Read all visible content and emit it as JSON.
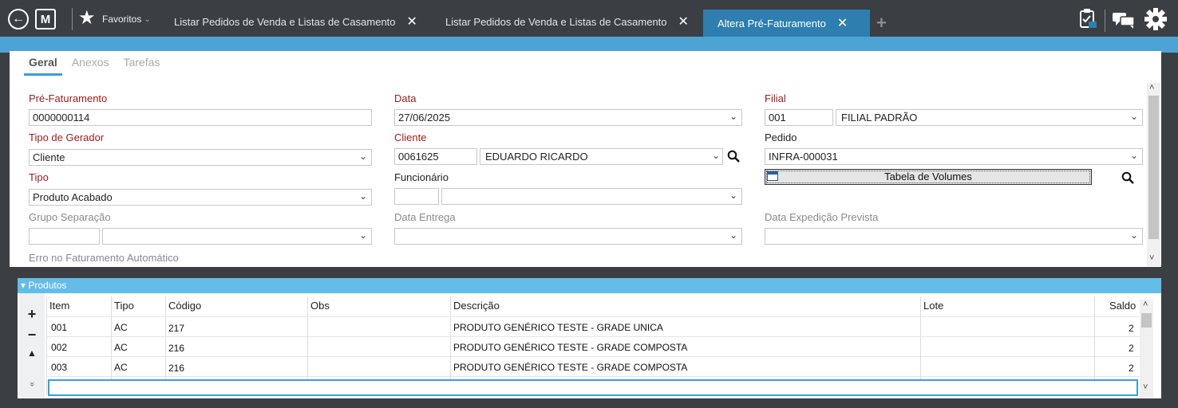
{
  "topbar": {
    "back_icon": "back-arrow-icon",
    "logo_letter": "M",
    "favorites_label": "Favoritos",
    "tabs": [
      {
        "label": "Listar Pedidos de Venda e Listas de Casamento"
      },
      {
        "label": "Listar Pedidos de Venda e Listas de Casamento"
      },
      {
        "label": "Altera Pré-Faturamento"
      }
    ],
    "close_glyph": "✕",
    "add_glyph": "+"
  },
  "subtabs": [
    "Geral",
    "Anexos",
    "Tarefas"
  ],
  "form": {
    "pre_faturamento": {
      "label": "Pré-Faturamento",
      "value": "0000000114"
    },
    "data": {
      "label": "Data",
      "value": "27/06/2025"
    },
    "filial": {
      "label": "Filial",
      "code": "001",
      "name": "FILIAL PADRÃO"
    },
    "tipo_gerador": {
      "label": "Tipo de Gerador",
      "value": "Cliente"
    },
    "cliente": {
      "label": "Cliente",
      "code": "0061625",
      "name": "EDUARDO RICARDO"
    },
    "pedido": {
      "label": "Pedido",
      "value": "INFRA-000031"
    },
    "tipo": {
      "label": "Tipo",
      "value": "Produto Acabado"
    },
    "funcionario": {
      "label": "Funcionário",
      "code": "",
      "name": ""
    },
    "tabela_volumes": {
      "label": "Tabela de Volumes"
    },
    "grupo_separacao": {
      "label": "Grupo Separação"
    },
    "data_entrega": {
      "label": "Data Entrega"
    },
    "data_expedicao": {
      "label": "Data Expedição Prevista"
    },
    "erro_faturamento": {
      "label": "Erro no Faturamento Automático"
    }
  },
  "produtos": {
    "title": "Produtos",
    "columns": [
      "Item",
      "Tipo",
      "Código",
      "Obs",
      "Descrição",
      "Lote",
      "Saldo"
    ],
    "rows": [
      {
        "item": "001",
        "tipo": "AC",
        "codigo": "217",
        "obs": "",
        "descricao": "PRODUTO GENÉRICO TESTE - GRADE UNICA",
        "lote": "",
        "saldo": "2"
      },
      {
        "item": "002",
        "tipo": "AC",
        "codigo": "216",
        "obs": "",
        "descricao": "PRODUTO GENÉRICO TESTE - GRADE COMPOSTA",
        "lote": "",
        "saldo": "2"
      },
      {
        "item": "003",
        "tipo": "AC",
        "codigo": "216",
        "obs": "",
        "descricao": "PRODUTO GENÉRICO TESTE - GRADE COMPOSTA",
        "lote": "",
        "saldo": "2"
      }
    ],
    "side_buttons": [
      "+",
      "−",
      "▲",
      "»"
    ]
  },
  "colors": {
    "topbar": "#3b3f44",
    "accent": "#2e7eb0",
    "strip": "#4ca3d4",
    "required_label": "#9b1b1b",
    "section_header": "#64bde8"
  }
}
